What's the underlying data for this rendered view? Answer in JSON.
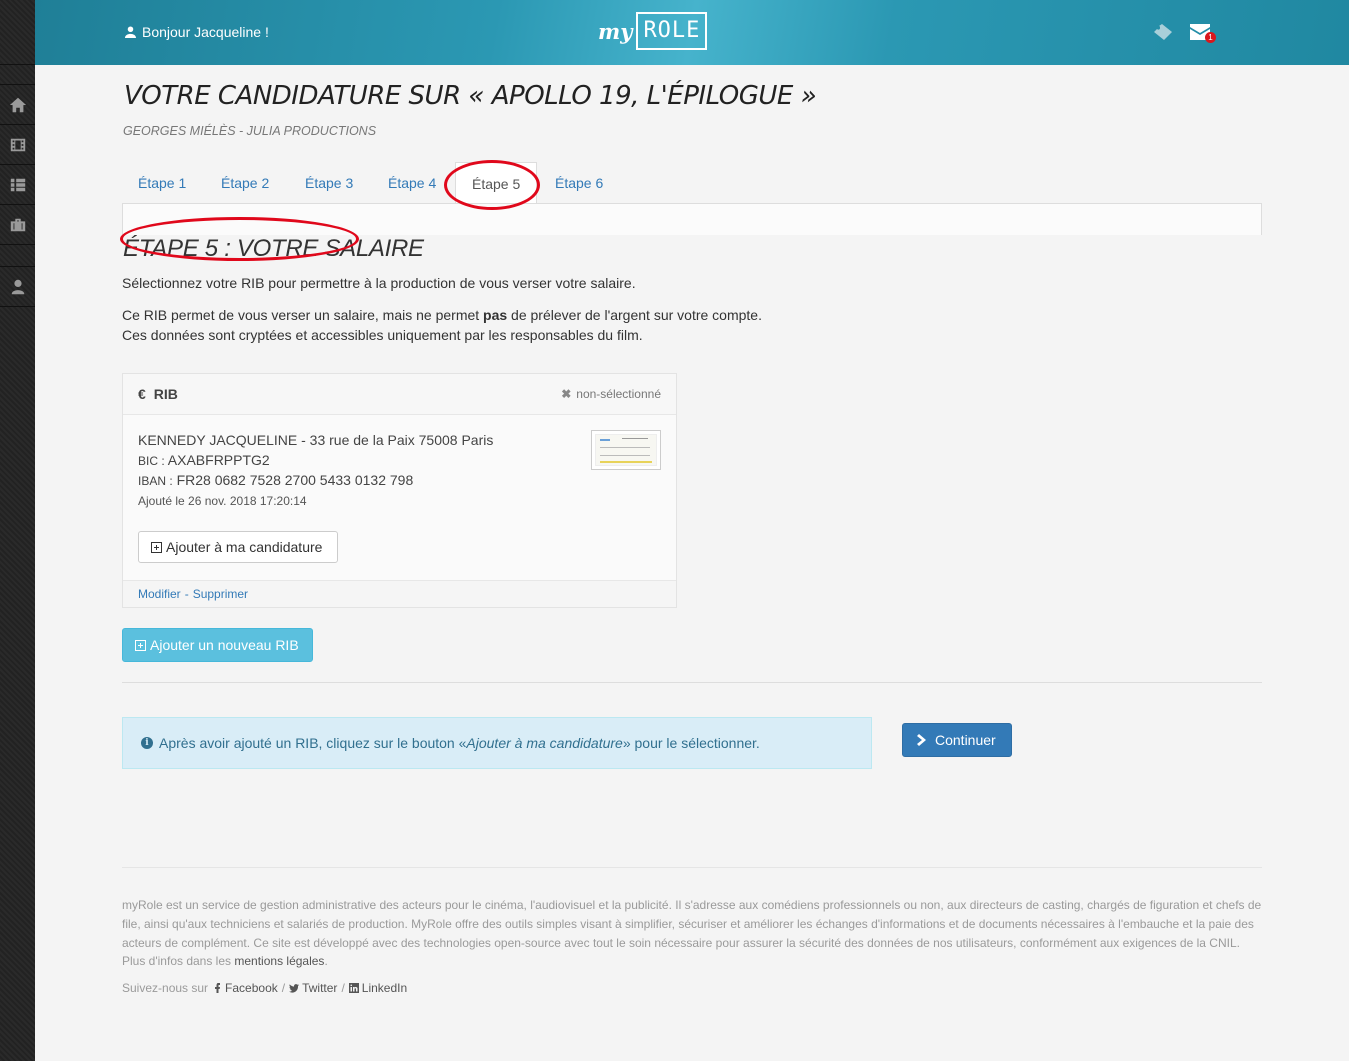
{
  "header": {
    "greeting": "Bonjour Jacqueline !",
    "logo_my": "my",
    "logo_role": "ROLE",
    "mail_count": "1"
  },
  "page": {
    "title": "VOTRE CANDIDATURE SUR « APOLLO 19, L'ÉPILOGUE »",
    "subtitle": "GEORGES MIÉLÈS - JULIA PRODUCTIONS"
  },
  "tabs": [
    {
      "label": "Étape 1",
      "active": false
    },
    {
      "label": "Étape 2",
      "active": false
    },
    {
      "label": "Étape 3",
      "active": false
    },
    {
      "label": "Étape 4",
      "active": false
    },
    {
      "label": "Étape 5",
      "active": true
    },
    {
      "label": "Étape 6",
      "active": false
    }
  ],
  "step": {
    "title": "ÉTAPE 5 : VOTRE SALAIRE",
    "intro": "Sélectionnez votre RIB pour permettre à la production de vous verser votre salaire.",
    "note_before": "Ce RIB permet de vous verser un salaire, mais ne permet ",
    "note_bold": "pas",
    "note_after": " de prélever de l'argent sur votre compte.",
    "note_line2": "Ces données sont cryptées et accessibles uniquement par les responsables du film."
  },
  "rib_panel": {
    "currency_symbol": "€",
    "title": "RIB",
    "status": "non-sélectionné",
    "holder": "KENNEDY JACQUELINE - 33 rue de la Paix 75008 Paris",
    "bic_label": "BIC :",
    "bic": "AXABFRPPTG2",
    "iban_label": "IBAN :",
    "iban": "FR28 0682 7528 2700 5433 0132 798",
    "added": "Ajouté le 26 nov. 2018 17:20:14",
    "add_button": "Ajouter à ma candidature",
    "edit_link": "Modifier",
    "separator": "-",
    "delete_link": "Supprimer"
  },
  "new_rib_button": "Ajouter un nouveau RIB",
  "alert": {
    "before": "Après avoir ajouté un RIB, cliquez sur le bouton «",
    "emph": "Ajouter à ma candidature",
    "after": "» pour le sélectionner."
  },
  "continue_button": "Continuer",
  "footer": {
    "text": "myRole est un service de gestion administrative des acteurs pour le cinéma, l'audiovisuel et la publicité. Il s'adresse aux comédiens professionnels ou non, aux directeurs de casting, chargés de figuration et chefs de file, ainsi qu'aux techniciens et salariés de production. MyRole offre des outils simples visant à simplifier, sécuriser et améliorer les échanges d'informations et de documents nécessaires à l'embauche et la paie des acteurs de complément. Ce site est développé avec des technologies open-source avec tout le soin nécessaire pour assurer la sécurité des données de nos utilisateurs, conformément aux exigences de la CNIL. Plus d'infos dans les",
    "legal_link": "mentions légales",
    "end": ".",
    "follow": "Suivez-nous sur",
    "facebook": "Facebook",
    "twitter": "Twitter",
    "linkedin": "LinkedIn",
    "slash": "/"
  },
  "colors": {
    "header": "#2b98b3",
    "link": "#337ab7",
    "info_button": "#5bc0de",
    "primary_button": "#337ab7",
    "annotation_circle": "#e0081b"
  },
  "icons": {
    "sidebar": [
      "home-icon",
      "film-icon",
      "list-icon",
      "briefcase-icon",
      "user-icon"
    ]
  }
}
